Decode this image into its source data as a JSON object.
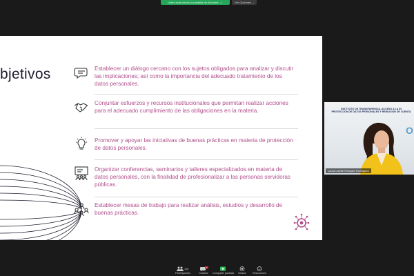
{
  "share_banner": {
    "status_text": "Usted está viendo la pantalla de (Nombre...)",
    "view_options_label": "Ver Opciones ⌄"
  },
  "slide": {
    "title": "bjetivos",
    "items": [
      {
        "icon": "chat-bubble-icon",
        "text": "Establecer un diálogo cercano con los sujetos obligados para analizar y discutir las implicaciones; así como la importancia del adecuado tratamiento de los datos personales."
      },
      {
        "icon": "handshake-icon",
        "text": "Conjuntar esfuerzos y recursos institucionales que permitan realizar acciones para el adecuado cumplimiento de las obligaciones en la materia."
      },
      {
        "icon": "lightbulb-icon",
        "text": "Promover y apoyar las iniciativas de buenas prácticas en materia de protección de datos personales."
      },
      {
        "icon": "presentation-board-icon",
        "text": "Organizar conferencias, seminarios y talleres especializados en materia de datos personales, con la finalidad de profesionalizar a las personas servidoras públicas."
      },
      {
        "icon": "team-icon",
        "text": "Establecer mesas de trabajo para realizar análisis, estudios y desarrollo de buenas prácticas."
      }
    ],
    "accent_color": "#b14e8c"
  },
  "video": {
    "banner_line1": "INSTITUTO DE TRANSPARENCIA, ACCESO A LA IN",
    "banner_line2": "PROTECCIÓN DE DATOS PERSONALES Y RENDICIÓN DE CUENTA",
    "participant_name": "Laura Lizette Enriquez Rodríguez"
  },
  "toolbar": {
    "participants_label": "Participantes",
    "participants_count": "110",
    "chat_label": "Chatear",
    "chat_badge": "6",
    "share_label": "Compartir pantalla",
    "record_label": "Grabar",
    "reactions_label": "Reacciones"
  }
}
